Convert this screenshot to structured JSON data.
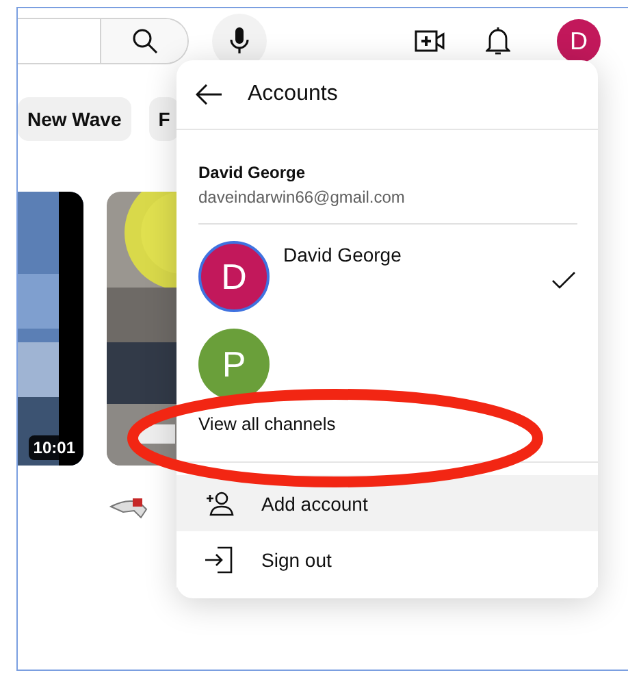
{
  "header": {
    "avatar_letter": "D"
  },
  "chips": [
    {
      "label": "New Wave"
    },
    {
      "label": "F"
    }
  ],
  "videos": [
    {
      "kind": "picture",
      "duration": "10:01"
    },
    {
      "kind": "picture"
    }
  ],
  "accounts_menu": {
    "title": "Accounts",
    "user_name": "David George",
    "email": "daveindarwin66@gmail.com",
    "channels": [
      {
        "letter": "D",
        "name": "David George",
        "color": "#c2185b",
        "selected": true
      },
      {
        "letter": "P",
        "color": "#6a9f3a",
        "selected": false
      }
    ],
    "view_all": "View all channels",
    "actions": [
      {
        "kind": "add",
        "label": "Add account",
        "hovered": true
      },
      {
        "kind": "signout",
        "label": "Sign out",
        "hovered": false
      }
    ]
  }
}
